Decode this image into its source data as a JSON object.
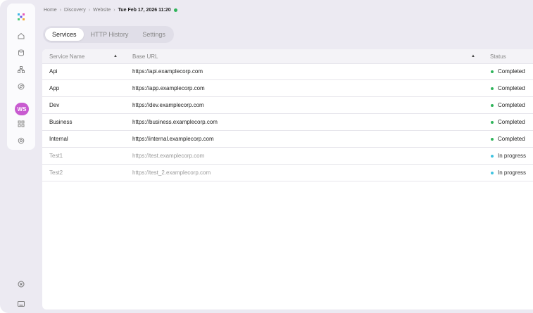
{
  "breadcrumb": {
    "items": [
      "Home",
      "Discovery",
      "Website"
    ],
    "current": "Tue Feb 17, 2026 11:20",
    "separator": "›"
  },
  "sidebar": {
    "workspace_initials": "WS",
    "items": [
      {
        "icon": "home-icon"
      },
      {
        "icon": "database-icon"
      },
      {
        "icon": "network-icon"
      },
      {
        "icon": "compass-icon"
      },
      {
        "icon": "workspace-avatar"
      },
      {
        "icon": "grid-icon"
      },
      {
        "icon": "settings-icon"
      }
    ],
    "bottom": [
      {
        "icon": "close-circle-icon"
      },
      {
        "icon": "terminal-icon"
      }
    ]
  },
  "tabs": [
    {
      "label": "Services",
      "active": true
    },
    {
      "label": "HTTP History",
      "active": false
    },
    {
      "label": "Settings",
      "active": false
    }
  ],
  "table": {
    "columns": [
      "Service Name",
      "Base URL",
      "Status"
    ],
    "rows": [
      {
        "name": "Api",
        "url": "https://api.examplecorp.com",
        "status": "Completed",
        "state": "done"
      },
      {
        "name": "App",
        "url": "https://app.examplecorp.com",
        "status": "Completed",
        "state": "done"
      },
      {
        "name": "Dev",
        "url": "https://dev.examplecorp.com",
        "status": "Completed",
        "state": "done"
      },
      {
        "name": "Business",
        "url": "https://business.examplecorp.com",
        "status": "Completed",
        "state": "done"
      },
      {
        "name": "Internal",
        "url": "https://internal.examplecorp.com",
        "status": "Completed",
        "state": "done"
      },
      {
        "name": "Test1",
        "url": "https://test.examplecorp.com",
        "status": "In progress",
        "state": "progress"
      },
      {
        "name": "Test2",
        "url": "https://test_2.examplecorp.com",
        "status": "In progress",
        "state": "progress"
      }
    ]
  },
  "colors": {
    "completed": "#2fb45a",
    "in_progress": "#3fc3e0",
    "workspace": "#c85bd0",
    "live_dot": "#2fb45a"
  }
}
